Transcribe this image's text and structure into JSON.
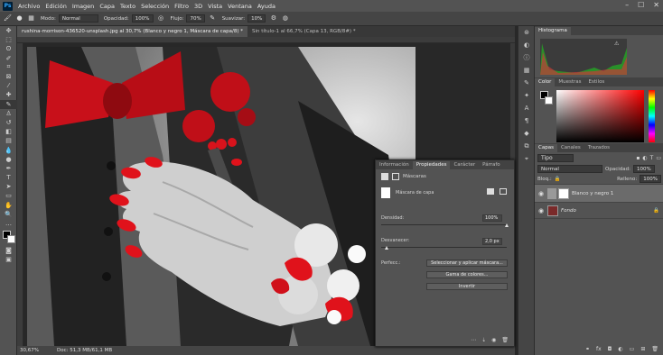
{
  "menu": [
    "Archivo",
    "Edición",
    "Imagen",
    "Capa",
    "Texto",
    "Selección",
    "Filtro",
    "3D",
    "Vista",
    "Ventana",
    "Ayuda"
  ],
  "options": {
    "mode_label": "Modo:",
    "mode_value": "Normal",
    "opacity_label": "Opacidad:",
    "opacity_value": "100%",
    "flow_label": "Flujo:",
    "flow_value": "70%",
    "smooth_label": "Suavizar:",
    "smooth_value": "10%"
  },
  "tabs": [
    {
      "label": "rushina-morrison-436520-unsplash.jpg al 30,7% (Blanco y negro 1, Máscara de capa/8) *",
      "active": true
    },
    {
      "label": "Sin título-1 al 66,7% (Capa 13, RGB/8#) *",
      "active": false
    }
  ],
  "status": {
    "zoom": "30,67%",
    "doc": "Doc: 51,3 MB/61,1 MB"
  },
  "histogram": {
    "title": "Histograma"
  },
  "color_panel": {
    "tabs": [
      "Color",
      "Muestras",
      "Estilos"
    ]
  },
  "layers_panel": {
    "tabs": [
      "Capas",
      "Canales",
      "Trazados"
    ],
    "filter": "Tipo",
    "blend": "Normal",
    "opacity_label": "Opacidad:",
    "opacity_value": "100%",
    "lock_label": "Bloq.:",
    "fill_label": "Relleno:",
    "fill_value": "100%",
    "layers": [
      {
        "name": "Blanco y negro 1",
        "selected": true
      },
      {
        "name": "Fondo",
        "selected": false
      }
    ]
  },
  "properties": {
    "tabs": [
      "Información",
      "Propiedades",
      "Carácter",
      "Párrafo"
    ],
    "header": "Máscaras",
    "mask_label": "Máscara de capa",
    "density_label": "Densidad:",
    "density_value": "100%",
    "density_level": 1.0,
    "feather_label": "Desvanecer:",
    "feather_value": "2,0 px",
    "feather_level": 0.05,
    "refine_label": "Perfecc.:",
    "btn_select": "Seleccionar y aplicar máscara...",
    "btn_range": "Gama de colores...",
    "btn_invert": "Invertir"
  },
  "colors": {
    "accent_red": "#e0121b",
    "panel": "#535353",
    "dark": "#282828"
  }
}
